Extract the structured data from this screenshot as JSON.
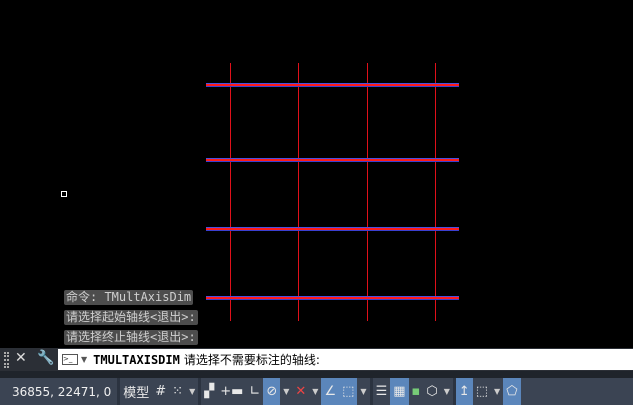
{
  "command_history": [
    "命令: TMultAxisDim",
    "请选择起始轴线<退出>:",
    "请选择终止轴线<退出>:"
  ],
  "command_line": {
    "command": "TMULTAXISDIM",
    "prompt": "请选择不需要标注的轴线:"
  },
  "status_bar": {
    "coordinates": "36855, 22471, 0",
    "model_label": "模型"
  },
  "colors": {
    "axis_line": "#e0101a",
    "axis_highlight": "#3a3fd0",
    "status_active": "#5b86bb"
  }
}
